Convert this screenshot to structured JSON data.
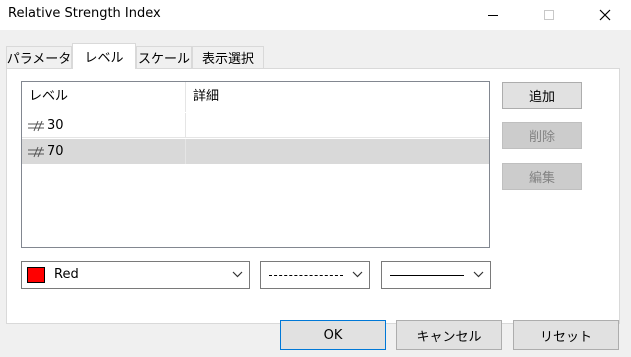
{
  "window": {
    "title": "Relative Strength Index"
  },
  "tabs": [
    {
      "label": "パラメータ",
      "active": false
    },
    {
      "label": "レベル",
      "active": true
    },
    {
      "label": "スケール",
      "active": false
    },
    {
      "label": "表示選択",
      "active": false
    }
  ],
  "levels_table": {
    "columns": [
      "レベル",
      "詳細"
    ],
    "rows": [
      {
        "level": "30",
        "detail": "",
        "icon": "level-line-icon",
        "selected": false
      },
      {
        "level": "70",
        "detail": "",
        "icon": "level-line-icon",
        "selected": true
      }
    ]
  },
  "side_buttons": {
    "add": "追加",
    "delete": "削除",
    "edit": "編集"
  },
  "line_settings": {
    "color_name": "Red",
    "color_hex": "#ff0000",
    "style": "dashed",
    "width": "thin"
  },
  "dialog_buttons": {
    "ok": "OK",
    "cancel": "キャンセル",
    "reset": "リセット"
  }
}
